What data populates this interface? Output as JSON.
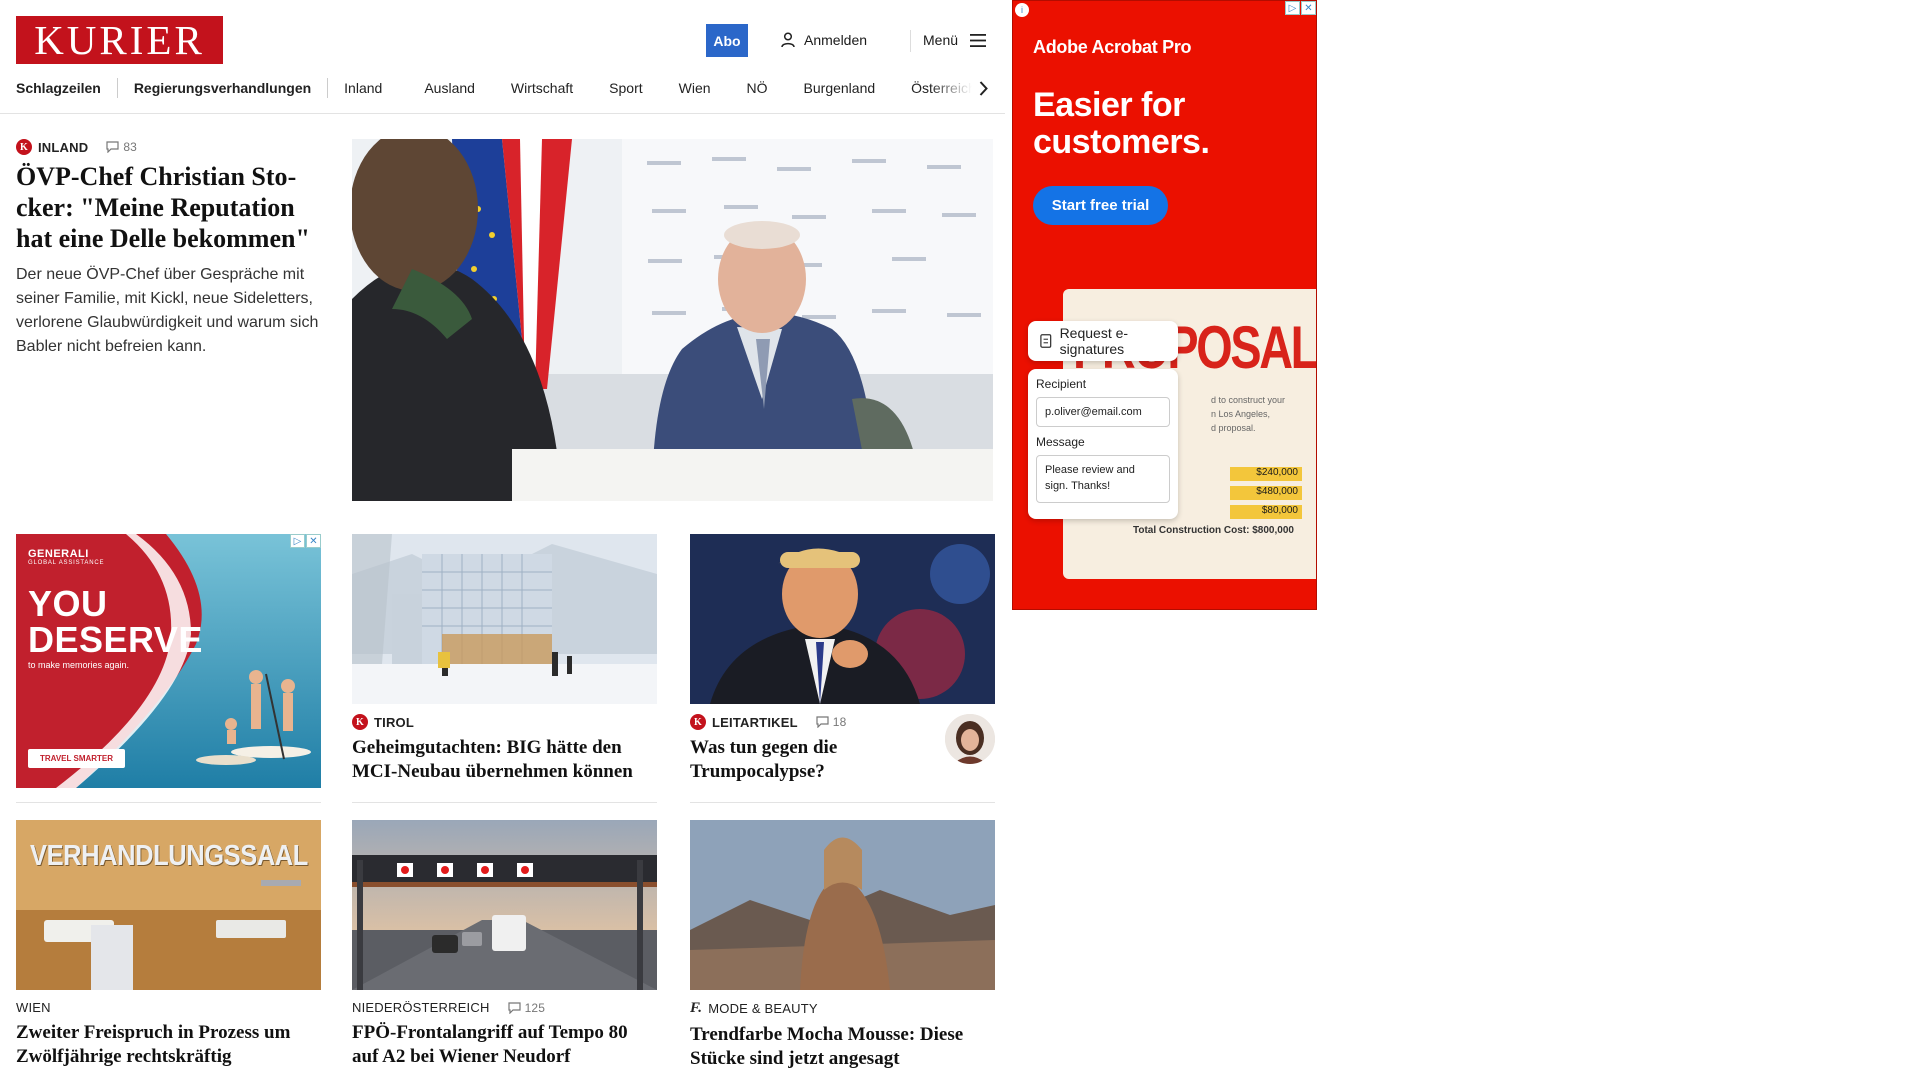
{
  "brand": {
    "logo": "KURIER",
    "color": "#c3121c"
  },
  "header": {
    "abo_label": "Abo",
    "login_label": "Anmelden",
    "menu_label": "Menü"
  },
  "nav": {
    "items": [
      "Schlagzeilen",
      "Regierungsverhandlungen",
      "Inland",
      "Ausland",
      "Wirtschaft",
      "Sport",
      "Wien",
      "NÖ",
      "Burgenland",
      "Österreich"
    ]
  },
  "lead": {
    "kicker": "INLAND",
    "comments": "83",
    "title": "ÖVP-Chef Christian Sto­cker: \"Meine Reputation hat eine Delle bekommen\"",
    "text": "Der neue ÖVP-Chef über Gespräche mit seiner Familie, mit Kickl, neue Sideletters, verlorene Glaubwürdigkeit und warum sich Babler nicht befreien kann."
  },
  "ad_small": {
    "brand": "GENERALI",
    "brand_sub": "GLOBAL ASSISTANCE",
    "headline_1": "YOU",
    "headline_2": "DESERVE",
    "subline": "to make memories again.",
    "cta": "TRAVEL SMARTER"
  },
  "cards_row1": [
    {
      "kicker": "TIROL",
      "title": "Geheimgutachten: BIG hätte den MCI-Neubau übernehmen können"
    },
    {
      "kicker": "LEITARTIKEL",
      "comments": "18",
      "title": "Was tun gegen die Trumpocalypse?"
    }
  ],
  "cards_row2": [
    {
      "kicker": "WIEN",
      "title": "Zweiter Freispruch in Prozess um Zwölfjährige rechtskräftig",
      "image_text": "VERHANDLUNGSSAAL"
    },
    {
      "kicker": "NIEDERÖSTERREICH",
      "comments": "125",
      "title": "FPÖ-Frontalangriff auf Tempo 80 auf A2 bei Wiener Neudorf"
    },
    {
      "kicker": "MODE & BEAUTY",
      "title": "Trendfarbe Mocha Mousse: Diese Stücke sind jetzt angesagt"
    }
  ],
  "ad_side": {
    "brand": "Adobe Acrobat Pro",
    "headline_1": "Easier for",
    "headline_2": "customers.",
    "cta": "Start free trial",
    "doc_word": "PROPOSAL",
    "doc_lines": [
      "d to construct your",
      "n Los Angeles,",
      "d proposal."
    ],
    "doc_amounts": [
      "$240,000",
      "$480,000",
      "$80,000"
    ],
    "doc_total": "Total Construction Cost: $800,000",
    "form_title": "Request e-signatures",
    "recipient_label": "Recipient",
    "recipient_value": "p.oliver@email.com",
    "message_label": "Message",
    "message_value": "Please review and sign. Thanks!",
    "color": "#eb1000"
  }
}
